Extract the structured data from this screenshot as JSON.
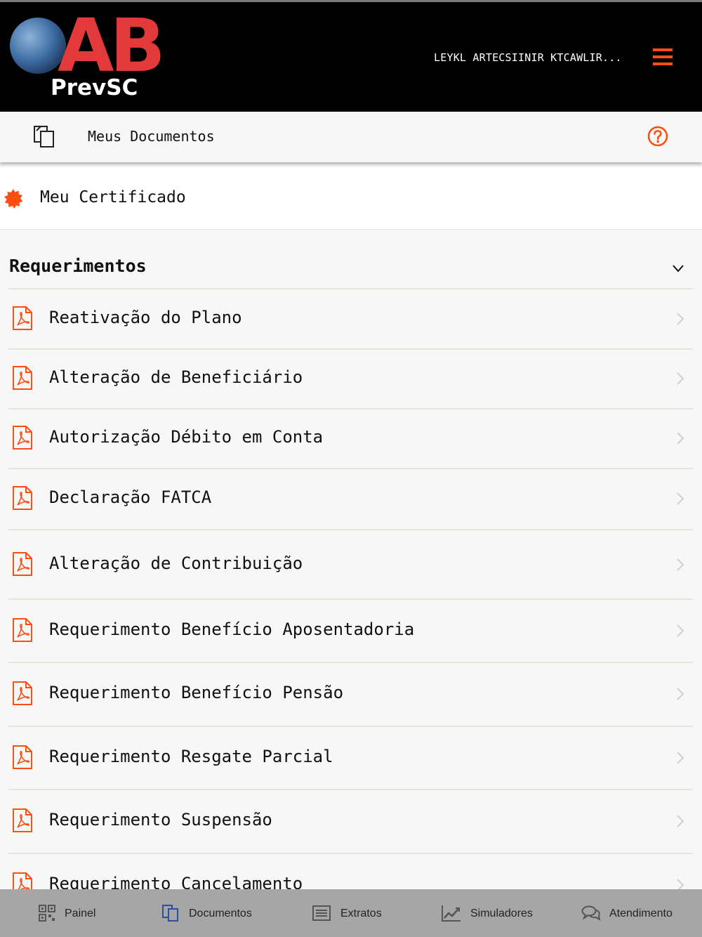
{
  "header": {
    "logo_text_main": "AB",
    "logo_text_sub": "PrevSC",
    "user_name": "LEYKL ARTECSIINIR KTCAWLIR..."
  },
  "subbar": {
    "title": "Meus Documentos"
  },
  "certificate": {
    "label": "Meu Certificado"
  },
  "section": {
    "title": "Requerimentos",
    "items": [
      {
        "label": "Reativação do Plano"
      },
      {
        "label": "Alteração de Beneficiário"
      },
      {
        "label": "Autorização Débito em Conta"
      },
      {
        "label": "Declaração FATCA"
      },
      {
        "label": "Alteração de Contribuição"
      },
      {
        "label": "Requerimento Benefício Aposentadoria"
      },
      {
        "label": "Requerimento Benefício Pensão"
      },
      {
        "label": "Requerimento Resgate Parcial"
      },
      {
        "label": "Requerimento Suspensão"
      },
      {
        "label": "Requerimento Cancelamento"
      }
    ]
  },
  "bottom_nav": [
    {
      "label": "Painel",
      "icon": "qr-code-icon"
    },
    {
      "label": "Documentos",
      "icon": "documents-icon"
    },
    {
      "label": "Extratos",
      "icon": "list-icon"
    },
    {
      "label": "Simuladores",
      "icon": "chart-line-icon"
    },
    {
      "label": "Atendimento",
      "icon": "chat-bubbles-icon"
    }
  ],
  "colors": {
    "accent": "#ff4e10",
    "header_bg": "#000000",
    "nav_bg": "#a6a6a6",
    "active_nav": "#2a4fa8"
  }
}
